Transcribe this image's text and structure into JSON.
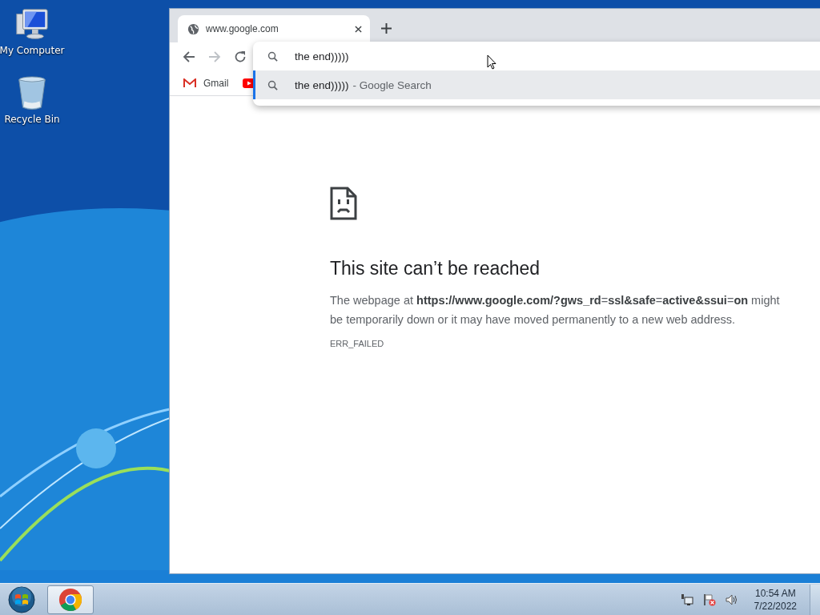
{
  "desktop_icons": [
    {
      "kind": "computer",
      "label": "My Computer"
    },
    {
      "kind": "recycle",
      "label": "Recycle Bin"
    }
  ],
  "browser": {
    "tabs": [
      {
        "title": "www.google.com",
        "selected": true
      }
    ],
    "nav": {
      "back_disabled": false,
      "forward_disabled": true
    },
    "omnibox": {
      "value": "the end)))))"
    },
    "suggestions": [
      {
        "text": "the end)))))",
        "suffix": "- Google Search",
        "selected": true
      }
    ],
    "bookmarks": [
      {
        "kind": "gmail",
        "label": "Gmail"
      },
      {
        "kind": "youtube"
      }
    ],
    "error": {
      "title": "This site can’t be reached",
      "message": "The webpage at **https://www.google.com/?gws_rd**=**ssl&safe**=**active&ssui**=**on** might be temporarily down or it may have moved permanently to a new web address.",
      "code": "ERR_FAILED"
    }
  },
  "taskbar": {
    "apps": [
      {
        "kind": "chrome",
        "selected": true
      }
    ],
    "time": "10:54 AM",
    "date": "7/22/2022"
  }
}
